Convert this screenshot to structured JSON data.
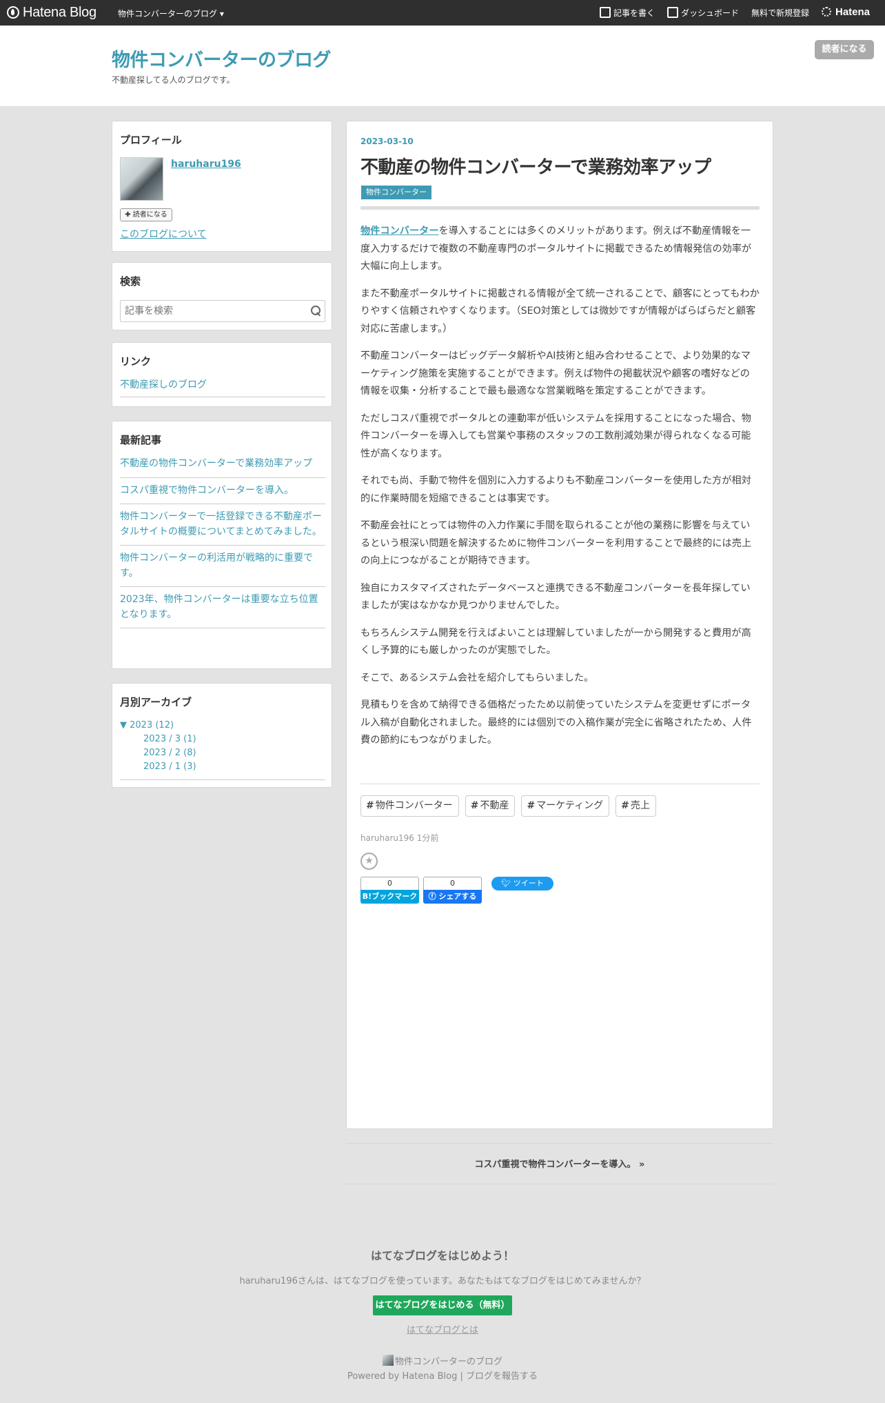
{
  "topbar": {
    "logo": "Hatena Blog",
    "blog_menu": "物件コンバーターのブログ",
    "write": "記事を書く",
    "dashboard": "ダッシュボード",
    "signup": "無料で新規登録",
    "hatena": "Hatena"
  },
  "header": {
    "title": "物件コンバーターのブログ",
    "description": "不動産探してる人のブログです。",
    "subscribe": "読者になる"
  },
  "sidebar": {
    "profile": {
      "heading": "プロフィール",
      "name": "haruharu196",
      "subscribe": "読者になる",
      "about": "このブログについて"
    },
    "search": {
      "heading": "検索",
      "placeholder": "記事を検索"
    },
    "links": {
      "heading": "リンク",
      "items": [
        "不動産探しのブログ"
      ]
    },
    "recent": {
      "heading": "最新記事",
      "items": [
        "不動産の物件コンバーターで業務効率アップ",
        "コスパ重視で物件コンバーターを導入。",
        "物件コンバーターで一括登録できる不動産ポータルサイトの概要についてまとめてみました。",
        "物件コンバーターの利活用が戦略的に重要です。",
        "2023年、物件コンバーターは重要な立ち位置となります。"
      ]
    },
    "archive": {
      "heading": "月別アーカイブ",
      "year": "▼ 2023 (12)",
      "months": [
        "2023 / 3 (1)",
        "2023 / 2 (8)",
        "2023 / 1 (3)"
      ]
    }
  },
  "entry": {
    "date": "2023-03-10",
    "title": "不動産の物件コンバーターで業務効率アップ",
    "category": "物件コンバーター",
    "lead_link": "物件コンバーター",
    "p1_rest": "を導入することには多くのメリットがあります。例えば不動産情報を一度入力するだけで複数の不動産専門のポータルサイトに掲載できるため情報発信の効率が大幅に向上します。",
    "paragraphs": [
      "また不動産ポータルサイトに掲載される情報が全て統一されることで、顧客にとってもわかりやすく信頼されやすくなります。（SEO対策としては微妙ですが情報がばらばらだと顧客対応に苦慮します。）",
      "不動産コンバーターはビッグデータ解析やAI技術と組み合わせることで、より効果的なマーケティング施策を実施することができます。例えば物件の掲載状況や顧客の嗜好などの情報を収集・分析することで最も最適なな営業戦略を策定することができます。",
      "ただしコスパ重視でポータルとの連動率が低いシステムを採用することになった場合、物件コンバーターを導入しても営業や事務のスタッフの工数削減効果が得られなくなる可能性が高くなります。",
      "それでも尚、手動で物件を個別に入力するよりも不動産コンバーターを使用した方が相対的に作業時間を短縮できることは事実です。",
      "不動産会社にとっては物件の入力作業に手間を取られることが他の業務に影響を与えているという根深い問題を解決するために物件コンバーターを利用することで最終的には売上の向上につながることが期待できます。",
      "独自にカスタマイズされたデータベースと連携できる不動産コンバーターを長年探していましたが実はなかなか見つかりませんでした。",
      "もちろんシステム開発を行えばよいことは理解していましたが一から開発すると費用が高くし予算的にも厳しかったのが実態でした。",
      "そこで、あるシステム会社を紹介してもらいました。",
      "見積もりを含めて納得できる価格だったため以前使っていたシステムを変更せずにポータル入稿が自動化されました。最終的には個別での入稿作業が完全に省略されたため、人件費の節約にもつながりました。"
    ],
    "hashtags": [
      "物件コンバーター",
      "不動産",
      "マーケティング",
      "売上"
    ],
    "author": "haruharu196",
    "time": "1分前",
    "bookmark_count": "0",
    "bookmark_label": "B!ブックマーク",
    "share_count": "0",
    "share_label": "シェアする",
    "tweet_label": "ツイート"
  },
  "pager": {
    "next": "コスパ重視で物件コンバーターを導入。 »"
  },
  "footer": {
    "promo_title": "はてなブログをはじめよう！",
    "promo_text": "haruharu196さんは、はてなブログを使っています。あなたもはてなブログをはじめてみませんか？",
    "promo_button": "はてなブログをはじめる（無料）",
    "promo_link": "はてなブログとは",
    "blog_name": "物件コンバーターのブログ",
    "powered_by": "Powered by",
    "hatena_blog": "Hatena Blog",
    "separator": "|",
    "report": "ブログを報告する"
  },
  "colors": {
    "accent": "#3e9bb3",
    "topbar": "#2f2f2f",
    "promo_button": "#1fa85b",
    "bookmark": "#00a4de",
    "facebook": "#1877f2",
    "twitter": "#1d9bf0"
  }
}
